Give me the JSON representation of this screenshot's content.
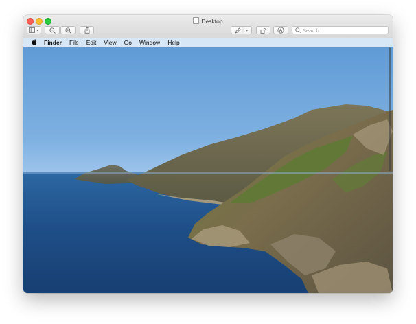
{
  "window": {
    "title": "Desktop"
  },
  "toolbar": {
    "sidebar_icon": "sidebar-icon",
    "zoom_out_icon": "zoom-out-icon",
    "zoom_in_icon": "zoom-in-icon",
    "share_icon": "share-icon",
    "markup_icon": "markup-pen-icon",
    "rotate_icon": "rotate-icon",
    "annotate_icon": "annotate-icon",
    "search_placeholder": "Search"
  },
  "menubar": {
    "apple_icon": "apple-icon",
    "items": [
      "Finder",
      "File",
      "Edit",
      "View",
      "Go",
      "Window",
      "Help"
    ]
  },
  "image": {
    "subject": "coastal cliffs wallpaper"
  }
}
